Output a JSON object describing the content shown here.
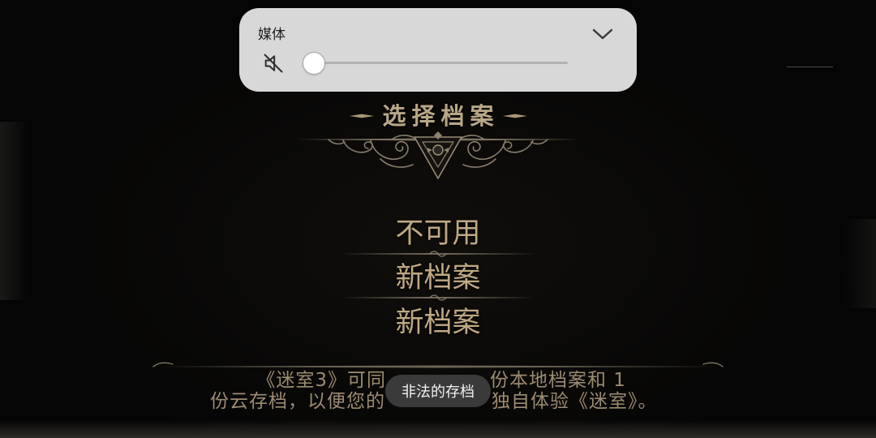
{
  "volume_panel": {
    "label": "媒体",
    "level": 0,
    "icons": {
      "speaker": "speaker-muted-icon",
      "expand": "chevron-down-icon"
    }
  },
  "save_screen": {
    "title": "选择档案",
    "slots": [
      {
        "label": "不可用"
      },
      {
        "label": "新档案"
      },
      {
        "label": "新档案"
      }
    ],
    "info_text": {
      "line1_left": "《迷室3》可同",
      "line1_right": "份本地档案和 1",
      "line2_left": "份云存档，以便您的",
      "line2_right": "独自体验《迷室》。"
    }
  },
  "toast": {
    "message": "非法的存档"
  },
  "colors": {
    "panel_background": "#d8d8d8",
    "accent_tan": "#bfa983",
    "info_text": "#9b8b70",
    "toast_background": "#3a3a3a",
    "background": "#050505"
  }
}
